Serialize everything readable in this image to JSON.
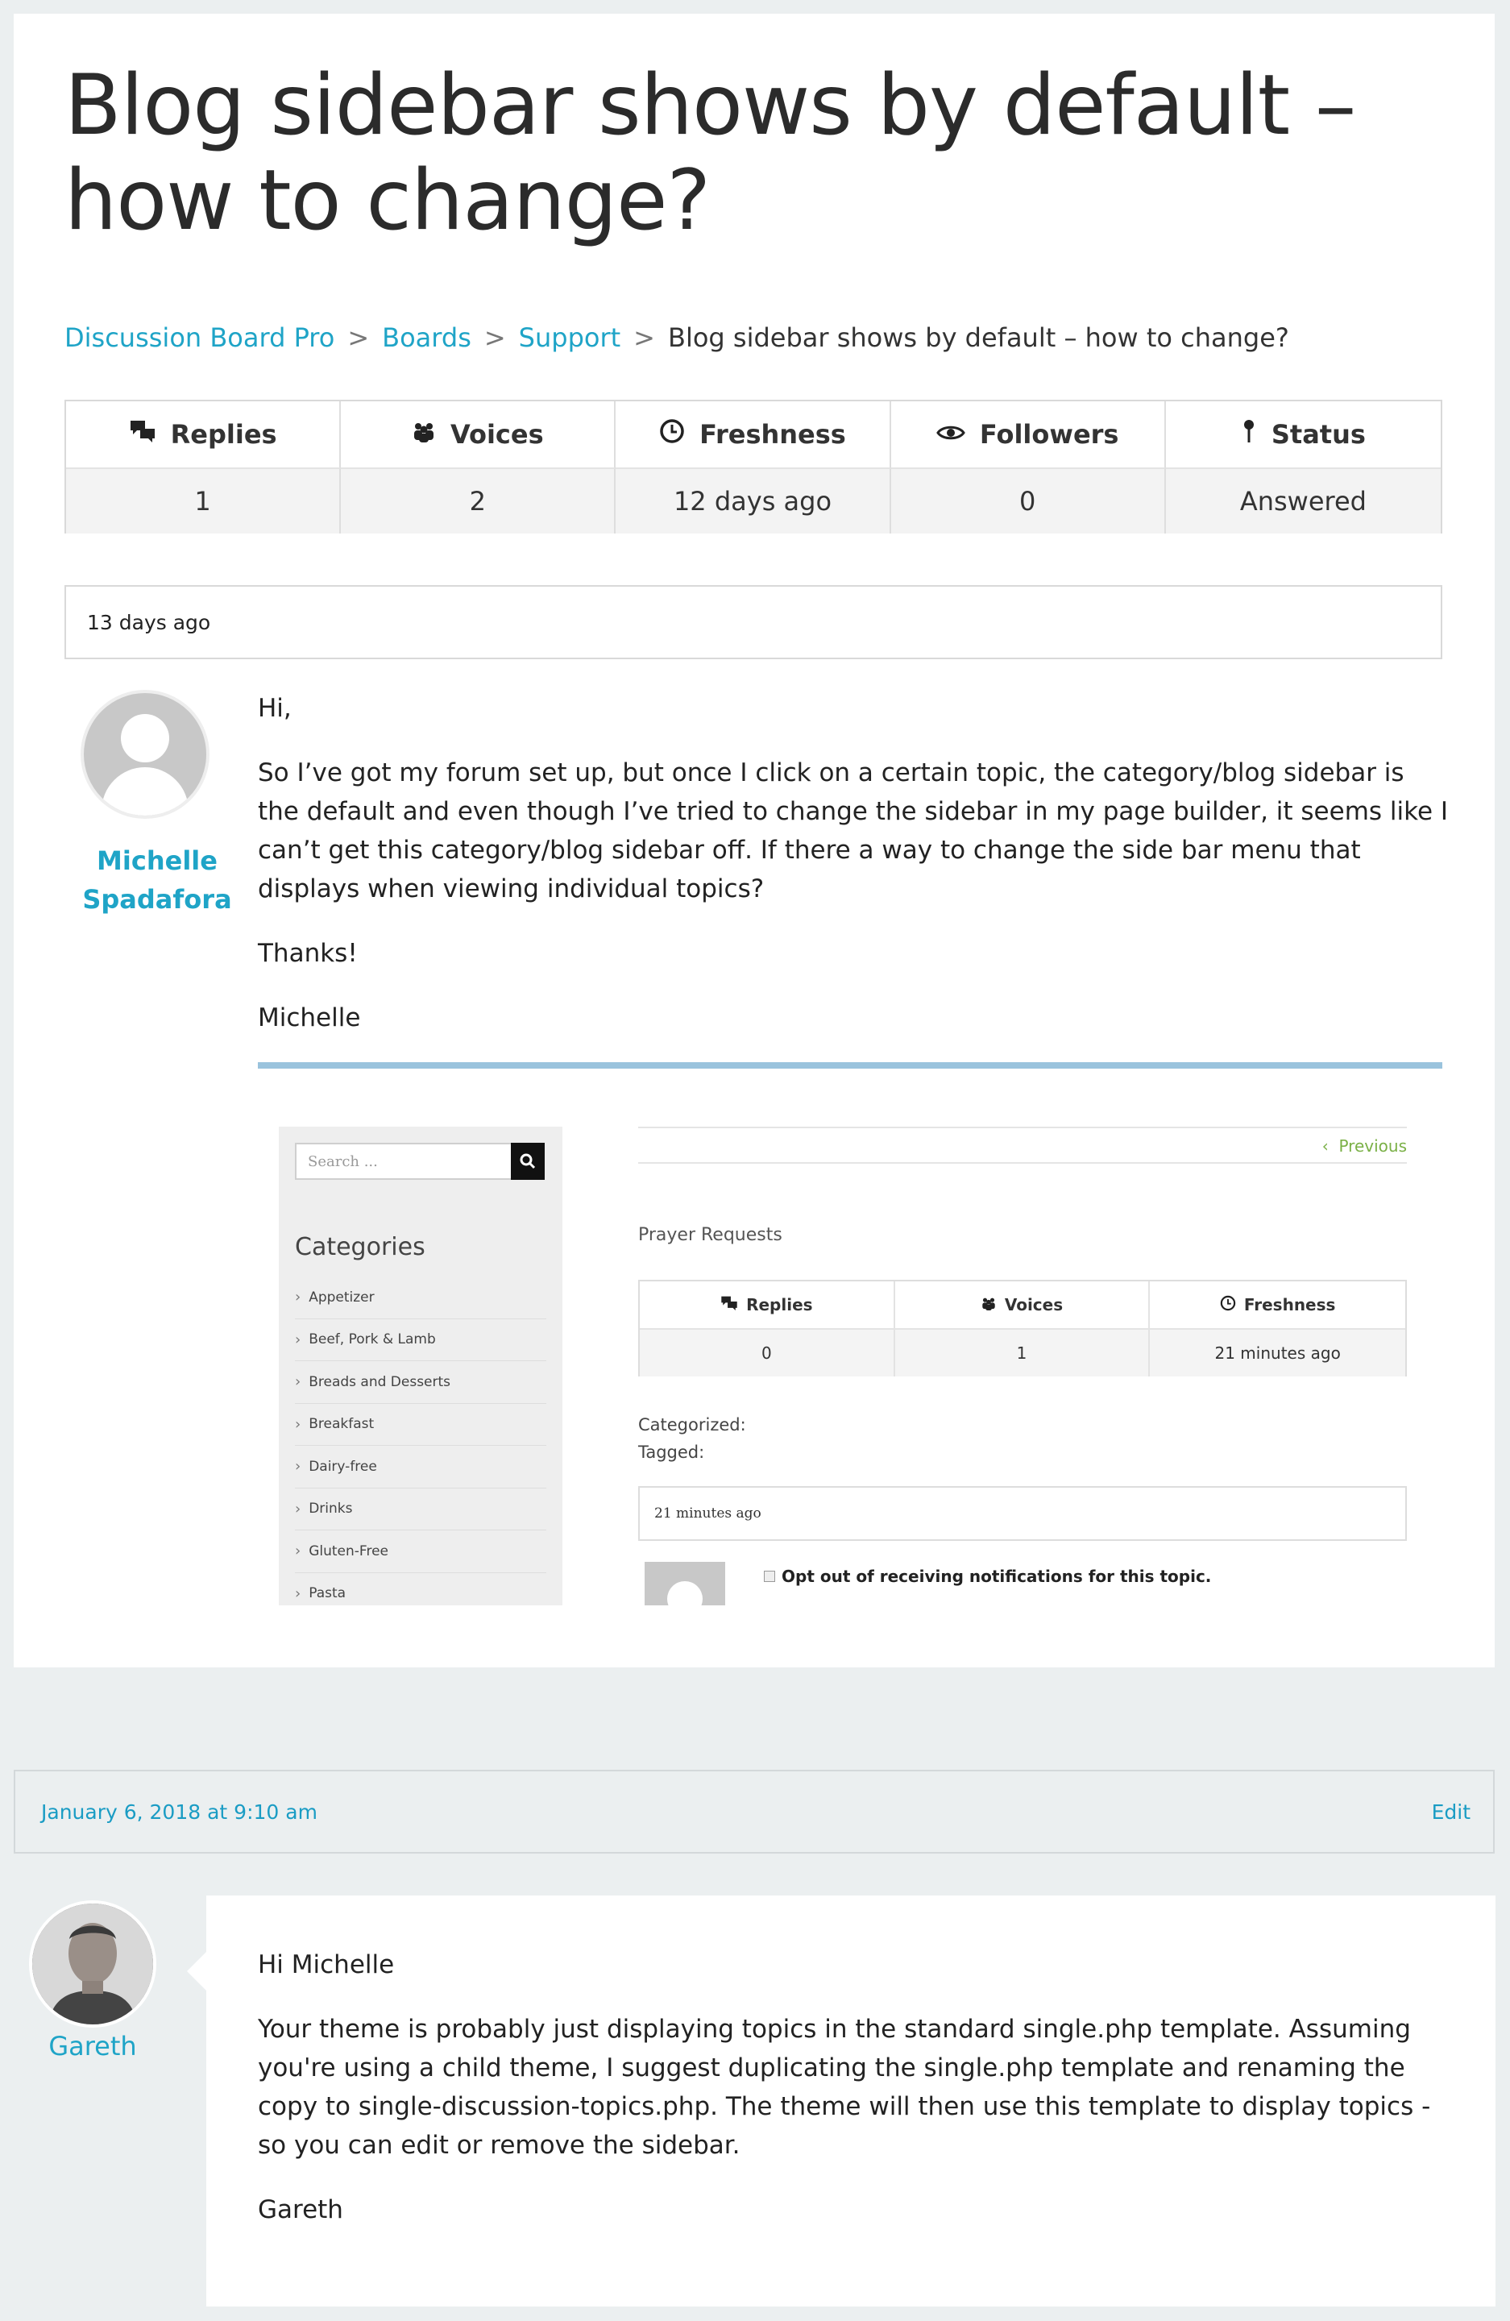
{
  "topic": {
    "title": "Blog sidebar shows by default – how to change?"
  },
  "breadcrumb": [
    {
      "label": "Discussion Board Pro"
    },
    {
      "label": "Boards"
    },
    {
      "label": "Support"
    },
    {
      "label": "Blog sidebar shows by default – how to change?"
    }
  ],
  "breadcrumb_separator": ">",
  "stats": {
    "headers": [
      "Replies",
      "Voices",
      "Freshness",
      "Followers",
      "Status"
    ],
    "icons": [
      "speech-bubbles-icon",
      "people-icon",
      "clock-icon",
      "eye-icon",
      "pin-icon"
    ],
    "values": [
      "1",
      "2",
      "12 days ago",
      "0",
      "Answered"
    ]
  },
  "first_post": {
    "date": "13 days ago",
    "author_line1": "Michelle",
    "author_line2": "Spadafora",
    "paragraphs": [
      "Hi,",
      "So I’ve got my forum set up, but once I click on a certain topic, the category/blog sidebar is the default and even though I’ve tried to change the sidebar in my page builder, it seems like I can’t get this category/blog sidebar off. If there a way to change the side bar menu that displays when viewing individual topics?",
      "Thanks!",
      "Michelle"
    ]
  },
  "screenshot": {
    "search_placeholder": "Search ...",
    "categories_heading": "Categories",
    "categories": [
      "Appetizer",
      "Beef, Pork & Lamb",
      "Breads and Desserts",
      "Breakfast",
      "Dairy-free",
      "Drinks",
      "Gluten-Free",
      "Pasta"
    ],
    "previous": "Previous",
    "forum_name": "Prayer Requests",
    "stats_headers": [
      "Replies",
      "Voices",
      "Freshness"
    ],
    "stats_values": [
      "0",
      "1",
      "21 minutes ago"
    ],
    "categorized": "Categorized:",
    "tagged": "Tagged:",
    "post_date": "21 minutes ago",
    "optout": "Opt out of receiving notifications for this topic."
  },
  "reply": {
    "date": "January 6, 2018 at 9:10 am",
    "edit": "Edit",
    "author": "Gareth",
    "paragraphs": [
      "Hi Michelle",
      "Your theme is probably just displaying topics in the standard single.php template. Assuming you're using a child theme, I suggest duplicating the single.php template and renaming the copy to single-discussion-topics.php. The theme will then use this template to display topics - so you can edit or remove the sidebar.",
      "Gareth"
    ]
  },
  "colors": {
    "link": "#1fa4c7",
    "accent_line": "#9ac3dd",
    "previous_link": "#7ab046"
  }
}
